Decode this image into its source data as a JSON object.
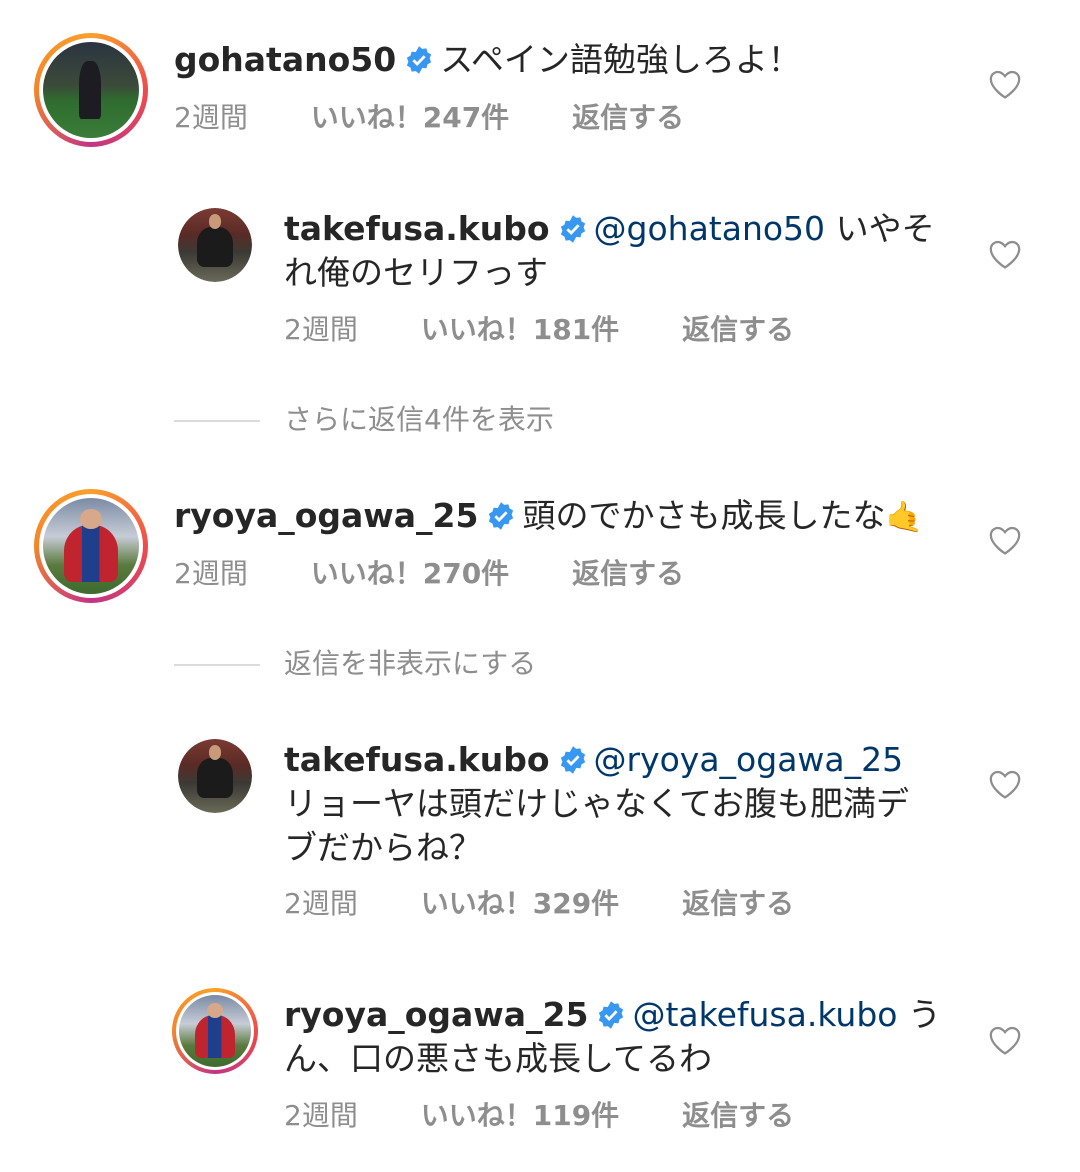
{
  "comments": [
    {
      "username": "gohatano50",
      "mention": "",
      "text": "スペイン語勉強しろよ！",
      "time": "2週間",
      "likes": "いいね！247件",
      "reply": "返信する"
    },
    {
      "username": "takefusa.kubo",
      "mention": "@gohatano50",
      "text": "いやそ",
      "text2": "れ俺のセリフっす",
      "time": "2週間",
      "likes": "いいね！181件",
      "reply": "返信する"
    },
    {
      "username": "ryoya_ogawa_25",
      "mention": "",
      "text": "頭のでかさも成長したな",
      "emoji": "🤙",
      "time": "2週間",
      "likes": "いいね！270件",
      "reply": "返信する"
    },
    {
      "username": "takefusa.kubo",
      "mention": "@ryoya_ogawa_25",
      "text": "リョーヤは頭だけじゃなくてお腹も肥満デ",
      "text2": "ブだからね？",
      "time": "2週間",
      "likes": "いいね！329件",
      "reply": "返信する"
    },
    {
      "username": "ryoya_ogawa_25",
      "mention": "@takefusa.kubo",
      "text": "う",
      "text2": "ん、口の悪さも成長してるわ",
      "time": "2週間",
      "likes": "いいね！119件",
      "reply": "返信する"
    }
  ],
  "toggles": {
    "view_more": "さらに返信4件を表示",
    "hide_replies": "返信を非表示にする"
  },
  "colors": {
    "verified": "#3897f0",
    "mention": "#00376b",
    "meta": "#8e8e8e"
  },
  "icons": {
    "like": "heart-outline-icon",
    "verified": "verified-badge-icon"
  }
}
